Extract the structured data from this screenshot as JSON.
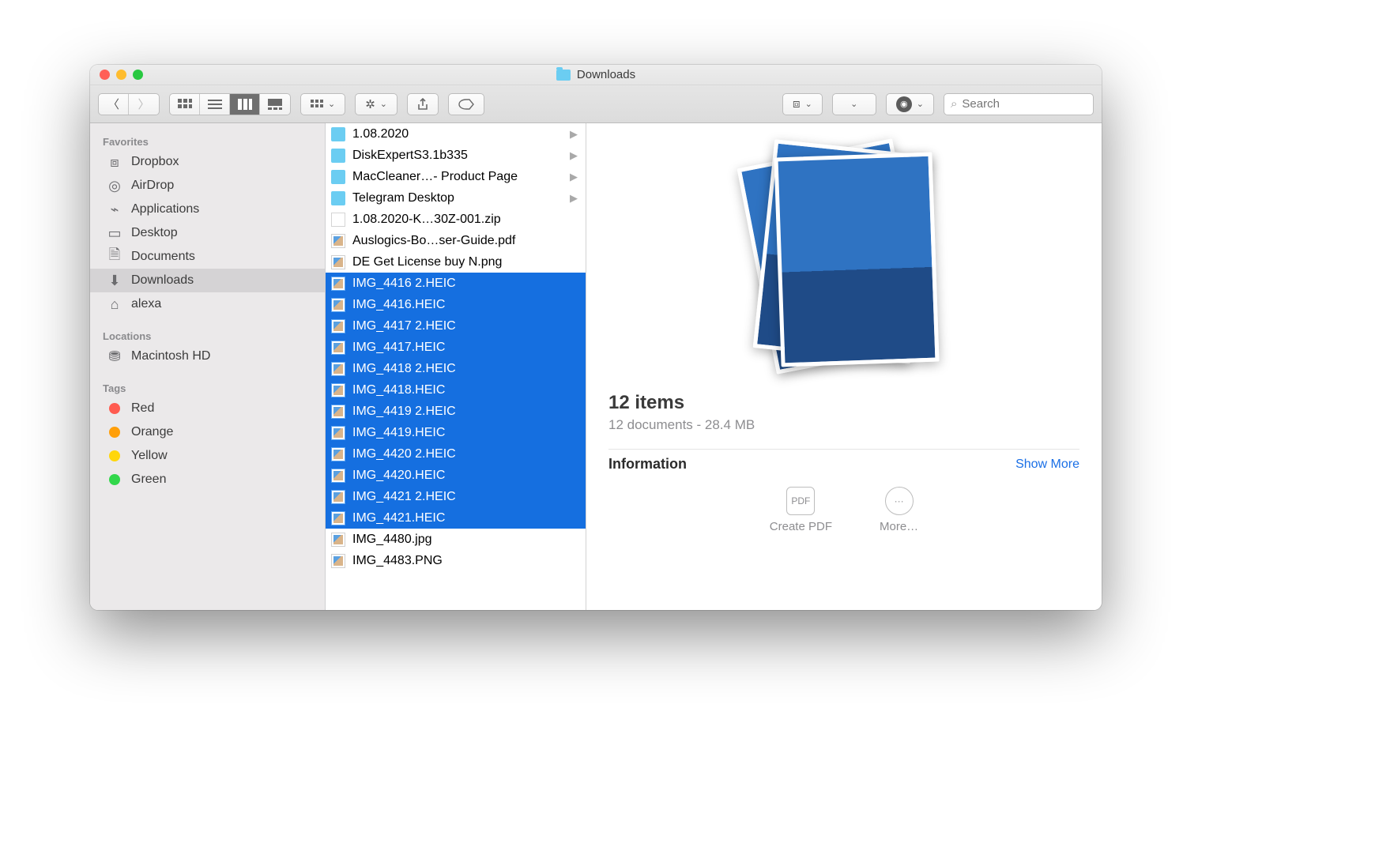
{
  "title": "Downloads",
  "search": {
    "placeholder": "Search"
  },
  "sidebar": {
    "favorites_label": "Favorites",
    "locations_label": "Locations",
    "tags_label": "Tags",
    "items": [
      {
        "label": "Dropbox",
        "icon": "dropbox"
      },
      {
        "label": "AirDrop",
        "icon": "airdrop"
      },
      {
        "label": "Applications",
        "icon": "apps"
      },
      {
        "label": "Desktop",
        "icon": "desktop"
      },
      {
        "label": "Documents",
        "icon": "docs"
      },
      {
        "label": "Downloads",
        "icon": "downloads",
        "active": true
      },
      {
        "label": "alexa",
        "icon": "home"
      }
    ],
    "locations": [
      {
        "label": "Macintosh HD",
        "icon": "disk"
      }
    ],
    "tags": [
      {
        "label": "Red",
        "color": "#ff5b50"
      },
      {
        "label": "Orange",
        "color": "#ff9f0a"
      },
      {
        "label": "Yellow",
        "color": "#ffd60a"
      },
      {
        "label": "Green",
        "color": "#32d74b"
      }
    ]
  },
  "files": [
    {
      "name": "1.08.2020",
      "type": "folder"
    },
    {
      "name": "DiskExpertS3.1b335",
      "type": "folder"
    },
    {
      "name": "MacCleaner…- Product Page",
      "type": "folder"
    },
    {
      "name": "Telegram Desktop",
      "type": "folder"
    },
    {
      "name": "1.08.2020-K…30Z-001.zip",
      "type": "zip"
    },
    {
      "name": "Auslogics-Bo…ser-Guide.pdf",
      "type": "pdf"
    },
    {
      "name": "DE Get License buy N.png",
      "type": "png"
    },
    {
      "name": "IMG_4416 2.HEIC",
      "type": "heic",
      "selected": true
    },
    {
      "name": "IMG_4416.HEIC",
      "type": "heic",
      "selected": true
    },
    {
      "name": "IMG_4417 2.HEIC",
      "type": "heic",
      "selected": true
    },
    {
      "name": "IMG_4417.HEIC",
      "type": "heic",
      "selected": true
    },
    {
      "name": "IMG_4418 2.HEIC",
      "type": "heic",
      "selected": true
    },
    {
      "name": "IMG_4418.HEIC",
      "type": "heic",
      "selected": true
    },
    {
      "name": "IMG_4419 2.HEIC",
      "type": "heic",
      "selected": true
    },
    {
      "name": "IMG_4419.HEIC",
      "type": "heic",
      "selected": true
    },
    {
      "name": "IMG_4420 2.HEIC",
      "type": "heic",
      "selected": true
    },
    {
      "name": "IMG_4420.HEIC",
      "type": "heic",
      "selected": true
    },
    {
      "name": "IMG_4421 2.HEIC",
      "type": "heic",
      "selected": true
    },
    {
      "name": "IMG_4421.HEIC",
      "type": "heic",
      "selected": true
    },
    {
      "name": "IMG_4480.jpg",
      "type": "jpg"
    },
    {
      "name": "IMG_4483.PNG",
      "type": "png"
    }
  ],
  "preview": {
    "count_label": "12 items",
    "sub_label": "12 documents - 28.4 MB",
    "info_label": "Information",
    "show_more": "Show More",
    "create_pdf": "Create PDF",
    "more": "More…"
  }
}
